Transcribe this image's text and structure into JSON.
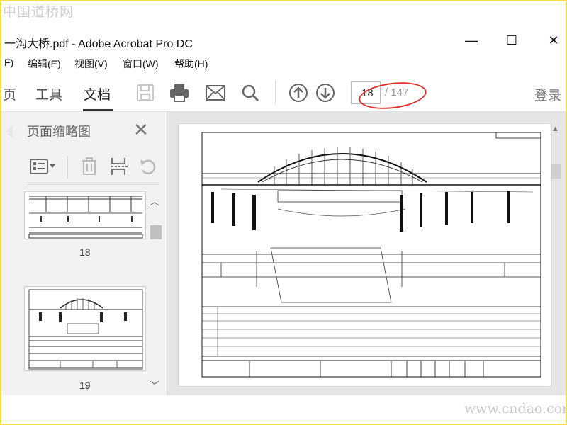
{
  "watermarks": {
    "top": "中国道桥网",
    "bottom": "www.cndao.com"
  },
  "window": {
    "title": "一沟大桥.pdf - Adobe Acrobat Pro DC",
    "minimize": "—",
    "maximize": "☐",
    "close": "✕"
  },
  "menu": [
    "F)",
    "编辑(E)",
    "视图(V)",
    "窗口(W)",
    "帮助(H)"
  ],
  "toolbar": {
    "tabs": [
      "页",
      "工具",
      "文档"
    ],
    "active_tab": "文档",
    "page_current": "18",
    "page_total": "/ 147",
    "login": "登录"
  },
  "panel": {
    "title": "页面缩略图",
    "close": "✕",
    "thumbnails": [
      {
        "label": "18"
      },
      {
        "label": "19"
      }
    ]
  },
  "icons": {
    "save": "save-icon",
    "print": "print-icon",
    "mail": "mail-icon",
    "search": "search-icon",
    "prev": "page-up-icon",
    "next": "page-down-icon",
    "thumb_options": "thumbnail-options-icon",
    "delete": "trash-icon",
    "extract": "extract-pages-icon",
    "rotate": "rotate-icon"
  },
  "colors": {
    "highlight": "#e03030",
    "frame": "#f0e04a"
  }
}
